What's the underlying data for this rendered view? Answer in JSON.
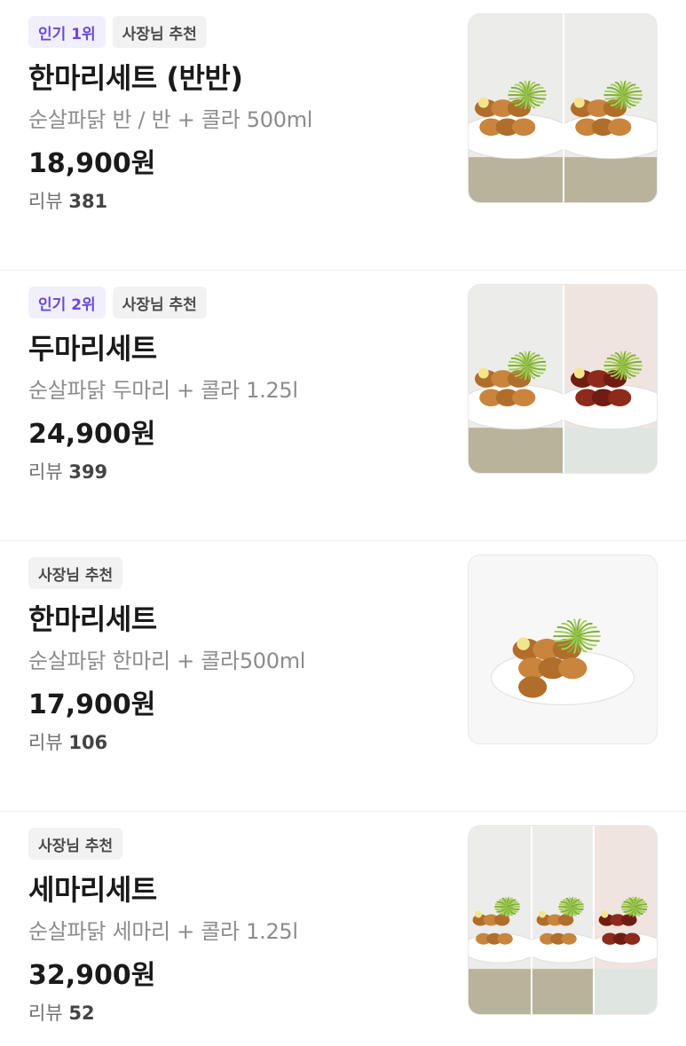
{
  "menu": [
    {
      "badges": [
        {
          "type": "popular",
          "label": "인기 1위"
        },
        {
          "type": "owner",
          "label": "사장님 추천"
        }
      ],
      "name": "한마리세트 (반반)",
      "description": "순살파닭 반 / 반 + 콜라 500ml",
      "price": "18,900원",
      "review_label": "리뷰",
      "review_count": "381",
      "image_panels": [
        "fried",
        "fried"
      ]
    },
    {
      "badges": [
        {
          "type": "popular",
          "label": "인기 2위"
        },
        {
          "type": "owner",
          "label": "사장님 추천"
        }
      ],
      "name": "두마리세트",
      "description": "순살파닭 두마리 + 콜라 1.25l",
      "price": "24,900원",
      "review_label": "리뷰",
      "review_count": "399",
      "image_panels": [
        "fried",
        "spicy"
      ]
    },
    {
      "badges": [
        {
          "type": "owner",
          "label": "사장님 추천"
        }
      ],
      "name": "한마리세트",
      "description": "순살파닭 한마리 + 콜라500ml",
      "price": "17,900원",
      "review_label": "리뷰",
      "review_count": "106",
      "image_panels": [
        "single"
      ]
    },
    {
      "badges": [
        {
          "type": "owner",
          "label": "사장님 추천"
        }
      ],
      "name": "세마리세트",
      "description": "순살파닭 세마리 + 콜라 1.25l",
      "price": "32,900원",
      "review_label": "리뷰",
      "review_count": "52",
      "image_panels": [
        "fried",
        "fried",
        "spicy"
      ]
    }
  ],
  "colors": {
    "popular_badge_bg": "#f1effc",
    "popular_badge_text": "#6a49d8",
    "owner_badge_bg": "#f2f2f3",
    "owner_badge_text": "#4a4a4a"
  }
}
